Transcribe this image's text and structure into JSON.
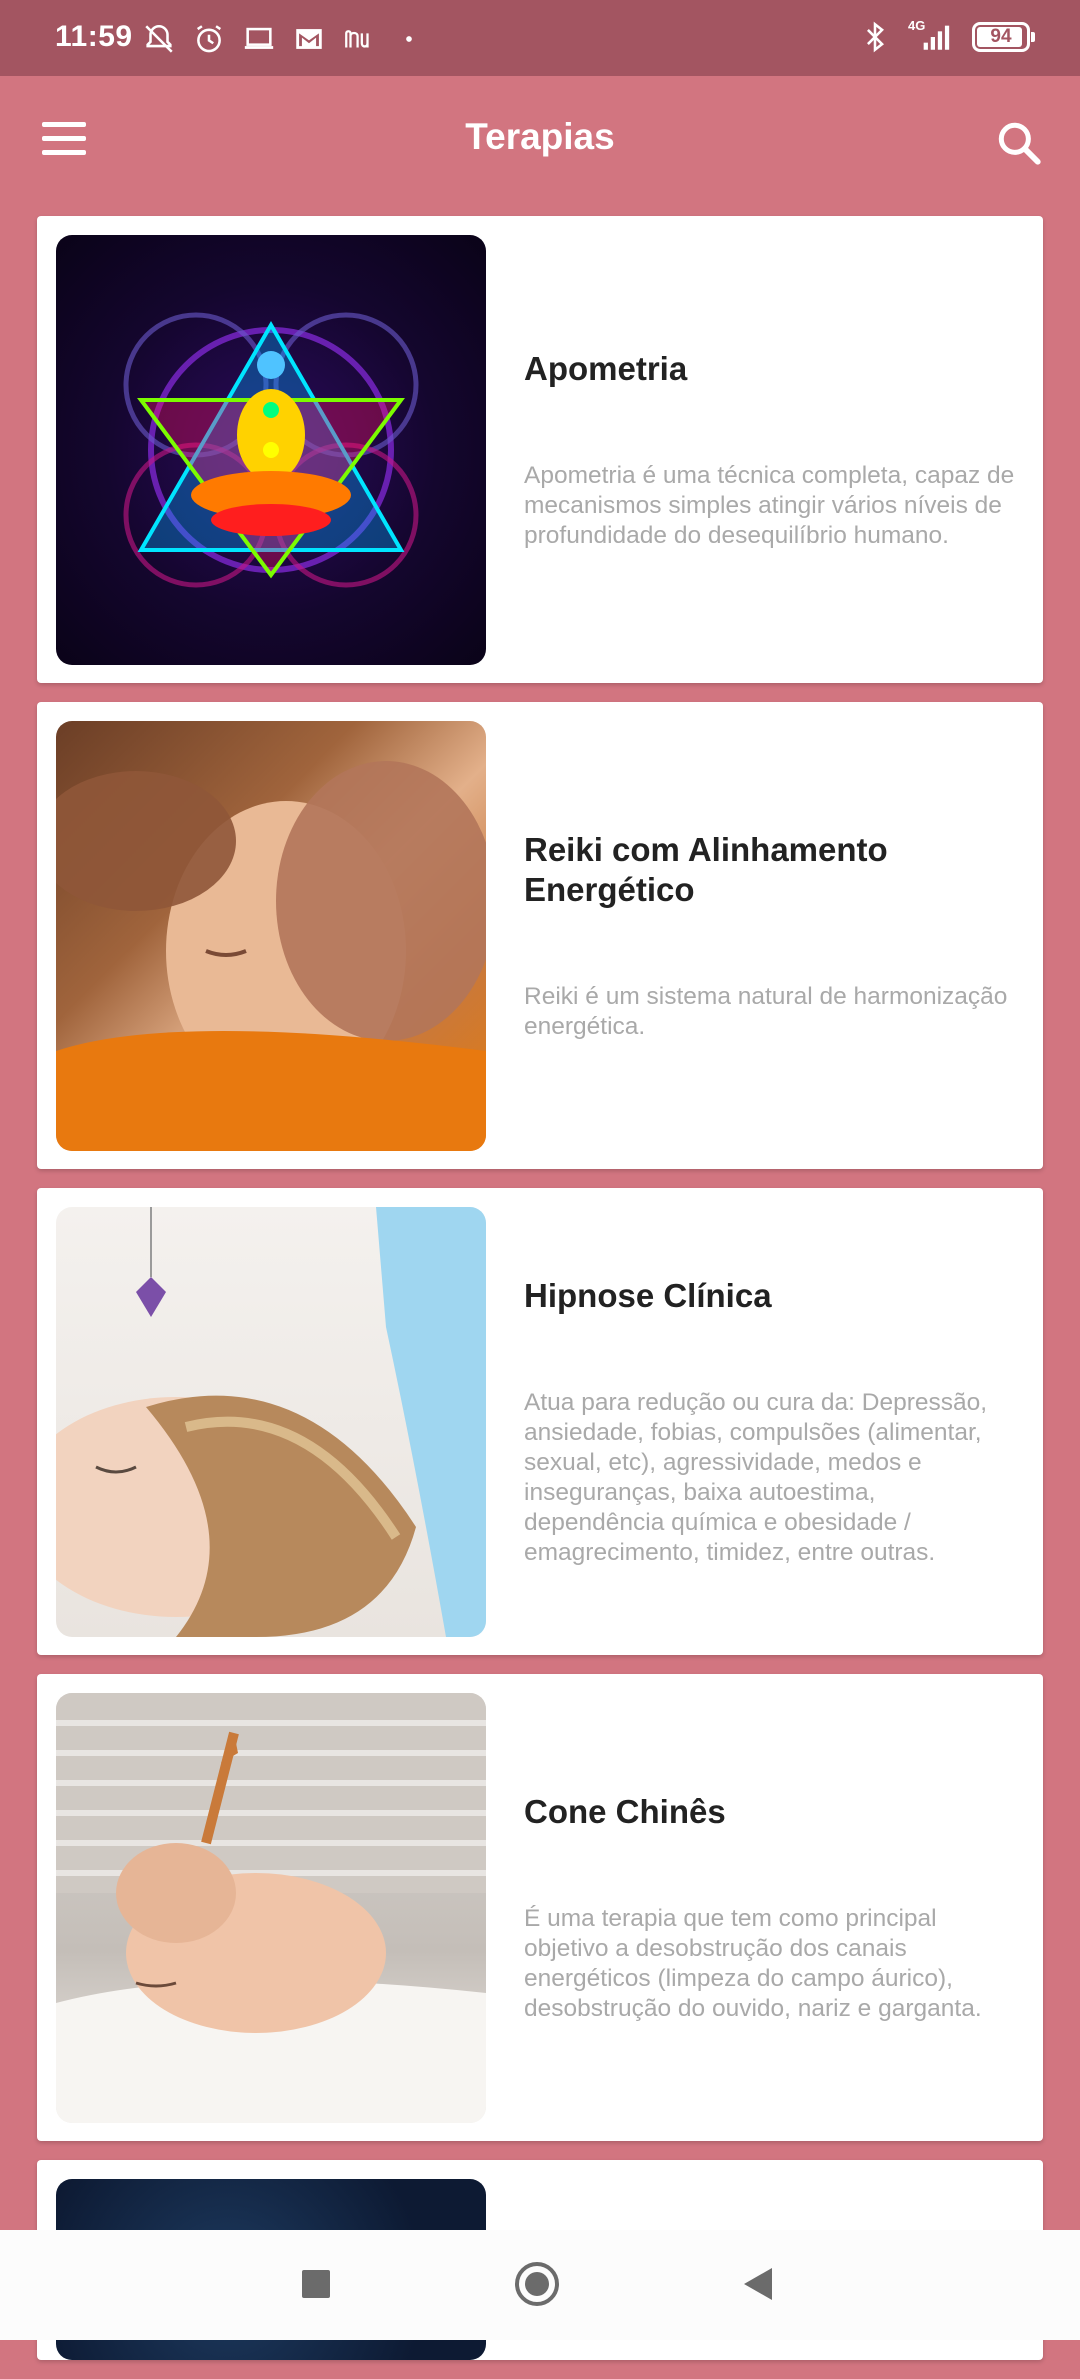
{
  "status_bar": {
    "time": "11:59",
    "network": "4G",
    "battery": "94",
    "left_icons": [
      "notifications-off-icon",
      "alarm-icon",
      "laptop-icon",
      "gmail-icon",
      "nu-icon",
      "dot-icon"
    ],
    "right_icons": [
      "bluetooth-icon",
      "signal-icon",
      "battery-icon"
    ]
  },
  "app_bar": {
    "title": "Terapias",
    "menu_icon": "menu-icon",
    "search_icon": "search-icon"
  },
  "colors": {
    "background": "#d27580",
    "status_bar": "#a35561",
    "card": "#ffffff",
    "title_text": "#222222",
    "description_text": "#a9a9a9"
  },
  "therapies": [
    {
      "title": "Apometria",
      "description": "Apometria é uma técnica completa, capaz de mecanismos simples atingir vários níveis de profundidade do desequilíbrio humano."
    },
    {
      "title": "Reiki com Alinhamento Energético",
      "description": "Reiki é um sistema natural de harmonização energética."
    },
    {
      "title": "Hipnose Clínica",
      "description": "Atua para redução ou cura da: Depressão, ansiedade, fobias, compulsões (alimentar, sexual, etc), agressividade, medos e inseguranças, baixa autoestima, dependência química e obesidade / emagrecimento, timidez, entre outras."
    },
    {
      "title": "Cone Chinês",
      "description": "É uma terapia que tem como principal objetivo a desobstrução dos canais energéticos (limpeza do campo áurico), desobstrução do ouvido, nariz e garganta."
    }
  ],
  "nav_bar": {
    "icons": [
      "recents-icon",
      "home-icon",
      "back-icon"
    ]
  }
}
